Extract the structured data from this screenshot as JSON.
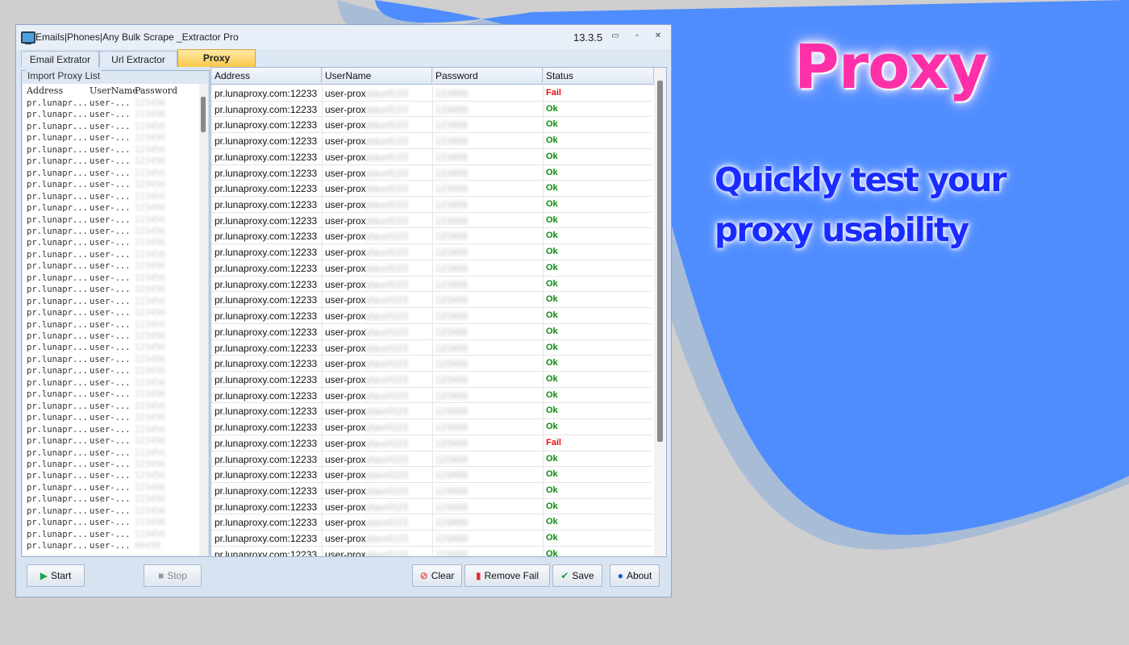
{
  "window": {
    "title": "Emails|Phones|Any Bulk Scrape _Extractor Pro",
    "version": "13.3.5",
    "controls": [
      "▭",
      "▫",
      "✕"
    ]
  },
  "tabs": [
    {
      "label": "Email Extrator"
    },
    {
      "label": "Url Extractor"
    },
    {
      "label": "Proxy"
    }
  ],
  "import": {
    "group_label": "Import Proxy List",
    "headers": [
      "Address",
      "UserName",
      "Password"
    ],
    "row_address": "pr.lunapr...",
    "row_user": "user-...",
    "row_pass": "123456",
    "last_row_pass": "00458"
  },
  "grid": {
    "headers": [
      "Address",
      "UserName",
      "Password",
      "Status"
    ],
    "address": "pr.lunaproxy.com:12233",
    "user_prefix": "user-prox",
    "user_hidden": "ylaunf123",
    "pass_hidden": "123456",
    "statuses": [
      "Fail",
      "Ok",
      "Ok",
      "Ok",
      "Ok",
      "Ok",
      "Ok",
      "Ok",
      "Ok",
      "Ok",
      "Ok",
      "Ok",
      "Ok",
      "Ok",
      "Ok",
      "Ok",
      "Ok",
      "Ok",
      "Ok",
      "Ok",
      "Ok",
      "Ok",
      "Fail",
      "Ok",
      "Ok",
      "Ok",
      "Ok",
      "Ok",
      "Ok",
      "Ok",
      "Ok"
    ],
    "status_colors": {
      "Ok": "#0a8a0a",
      "Fail": "#e81010"
    }
  },
  "buttons": {
    "start": "Start",
    "stop": "Stop",
    "clear": "Clear",
    "remove_fail": "Remove Fail",
    "save": "Save",
    "about": "About"
  },
  "promo": {
    "title": "Proxy",
    "subtitle": "Quickly test your proxy usability"
  },
  "colors": {
    "blob": "#4f8dff",
    "blob_shadow": "#a8bcd6"
  }
}
